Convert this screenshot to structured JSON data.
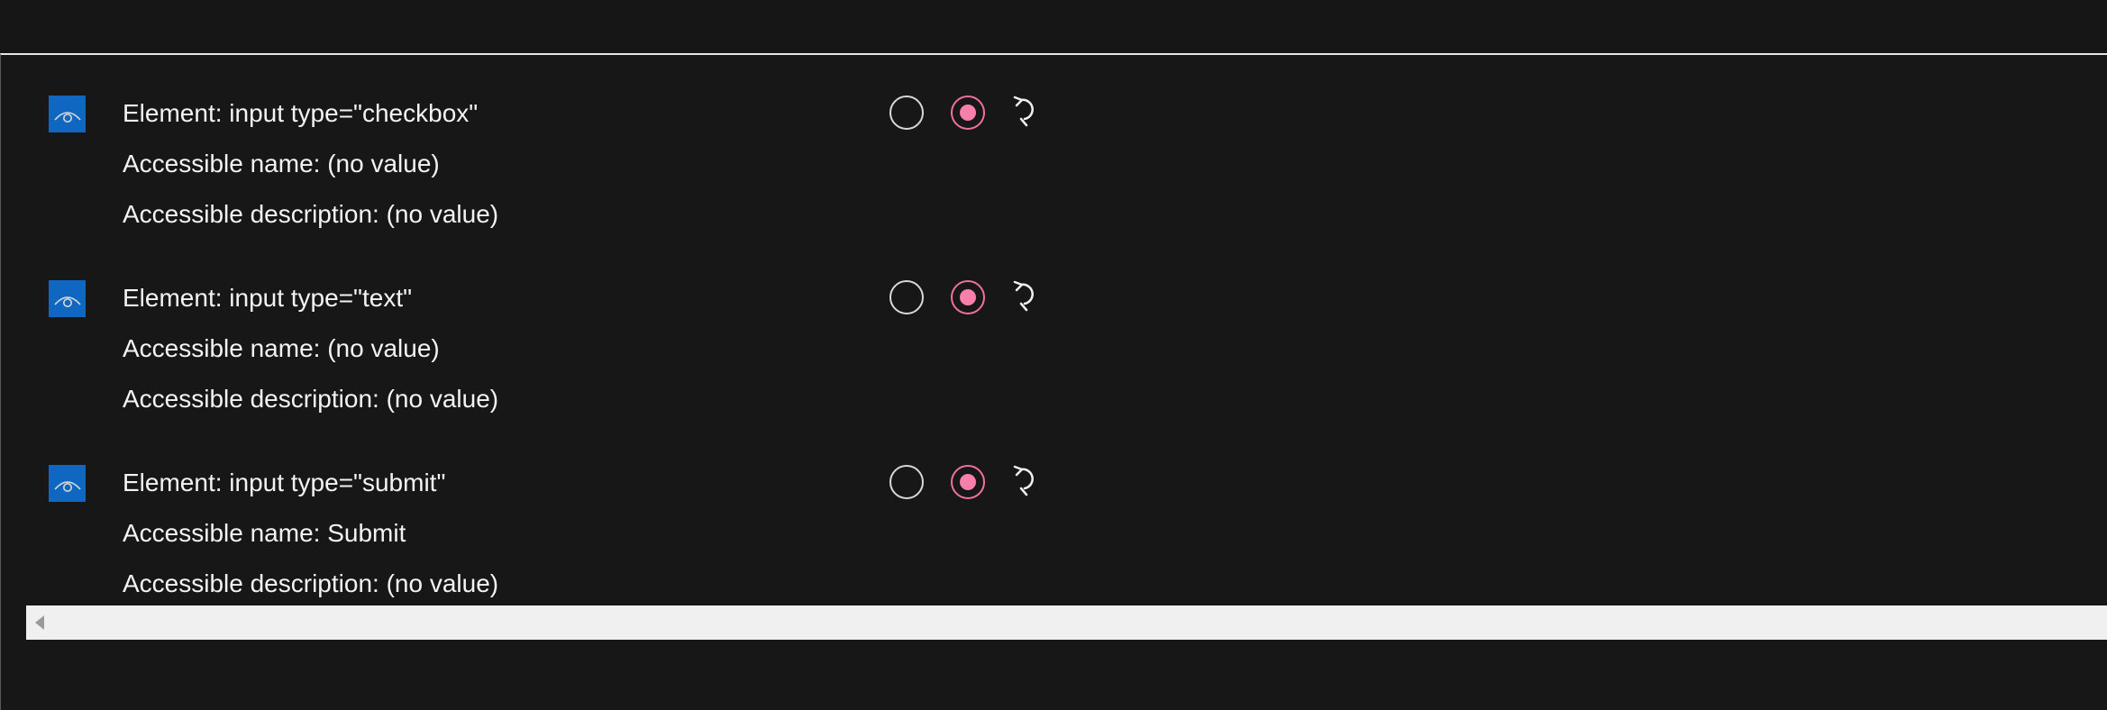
{
  "rows": [
    {
      "element": "Element: input type=\"checkbox\"",
      "name": "Accessible name: (no value)",
      "description": "Accessible description: (no value)",
      "visibility_icon": "eye-icon",
      "options": [
        "unselected",
        "selected"
      ],
      "reset_icon": "undo-icon"
    },
    {
      "element": "Element: input type=\"text\"",
      "name": "Accessible name: (no value)",
      "description": "Accessible description: (no value)",
      "visibility_icon": "eye-icon",
      "options": [
        "unselected",
        "selected"
      ],
      "reset_icon": "undo-icon"
    },
    {
      "element": "Element: input type=\"submit\"",
      "name": "Accessible name: Submit",
      "description": "Accessible description: (no value)",
      "visibility_icon": "eye-icon",
      "options": [
        "unselected",
        "selected"
      ],
      "reset_icon": "undo-icon"
    }
  ],
  "colors": {
    "background": "#161616",
    "accent_blue": "#0f67c2",
    "selected_pink": "#f77fa9",
    "text": "#f3f3f3"
  },
  "scrollbar": {
    "orientation": "horizontal",
    "arrow_icon": "scroll-left-arrow-icon"
  }
}
